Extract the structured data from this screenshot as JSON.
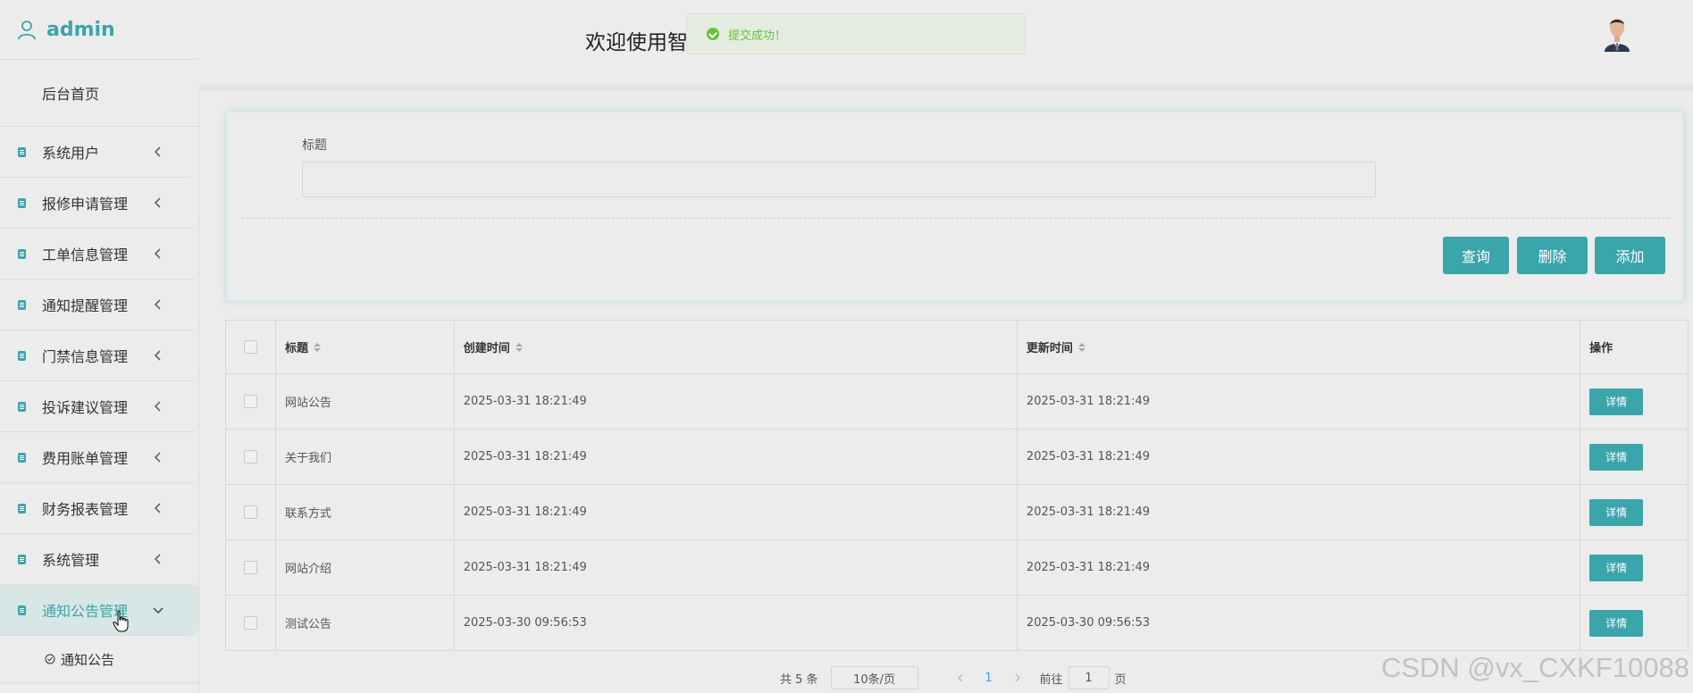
{
  "sidebar": {
    "username": "admin",
    "home": "后台首页",
    "items": [
      {
        "label": "系统用户"
      },
      {
        "label": "报修申请管理"
      },
      {
        "label": "工单信息管理"
      },
      {
        "label": "通知提醒管理"
      },
      {
        "label": "门禁信息管理"
      },
      {
        "label": "投诉建议管理"
      },
      {
        "label": "费用账单管理"
      },
      {
        "label": "财务报表管理"
      },
      {
        "label": "系统管理"
      },
      {
        "label": "通知公告管理",
        "active": true
      }
    ],
    "sub_item": "通知公告"
  },
  "header": {
    "welcome": "欢迎使用智",
    "toast": "提交成功！"
  },
  "search": {
    "label": "标题",
    "value": "",
    "buttons": {
      "query": "查询",
      "delete": "删除",
      "add": "添加"
    }
  },
  "table": {
    "headers": {
      "title": "标题",
      "created": "创建时间",
      "updated": "更新时间",
      "actions": "操作"
    },
    "rows": [
      {
        "title": "网站公告",
        "created": "2025-03-31 18:21:49",
        "updated": "2025-03-31 18:21:49",
        "action": "详情"
      },
      {
        "title": "关于我们",
        "created": "2025-03-31 18:21:49",
        "updated": "2025-03-31 18:21:49",
        "action": "详情"
      },
      {
        "title": "联系方式",
        "created": "2025-03-31 18:21:49",
        "updated": "2025-03-31 18:21:49",
        "action": "详情"
      },
      {
        "title": "网站介绍",
        "created": "2025-03-31 18:21:49",
        "updated": "2025-03-31 18:21:49",
        "action": "详情"
      },
      {
        "title": "测试公告",
        "created": "2025-03-30 09:56:53",
        "updated": "2025-03-30 09:56:53",
        "action": "详情"
      }
    ]
  },
  "pagination": {
    "total": "共 5 条",
    "page_size": "10条/页",
    "current": "1",
    "goto_label": "前往",
    "goto_value": "1",
    "page_suffix": "页"
  },
  "watermark": "CSDN @vx_CXKF10088",
  "colors": {
    "accent": "#3aa5ab",
    "success": "#67c23a",
    "link": "#409eff"
  }
}
